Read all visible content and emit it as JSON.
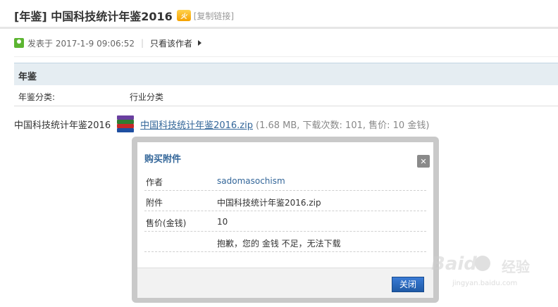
{
  "thread": {
    "title": "[年鉴] 中国科技统计年鉴2016",
    "badge_icon": "hot-badge-icon",
    "copy_link": "[复制链接]"
  },
  "meta": {
    "posted": "发表于 2017-1-9 09:06:52",
    "only_author": "只看该作者"
  },
  "type_table": {
    "header": "年鉴",
    "key": "年鉴分类:",
    "value": "行业分类"
  },
  "attachment": {
    "prefix": "中国科技统计年鉴2016",
    "icon": "winrar-archive-icon",
    "filename": "中国科技统计年鉴2016.zip",
    "info": "(1.68 MB, 下载次数: 101, 售价: 10 金钱)"
  },
  "dialog": {
    "title": "购买附件",
    "rows": [
      {
        "key": "作者",
        "value": "sadomasochism"
      },
      {
        "key": "附件",
        "value": "中国科技统计年鉴2016.zip"
      },
      {
        "key": "售价(金钱)",
        "value": "10"
      },
      {
        "key": "",
        "value": "抱歉，您的 金钱 不足，无法下载"
      }
    ],
    "close_button": "关闭"
  },
  "watermark": {
    "logo": "Baidu",
    "cn": "经验",
    "url": "jingyan.baidu.com"
  },
  "colors": {
    "accent": "#336699",
    "header_bg": "#e5edf2",
    "button": "#1f5aa6"
  }
}
